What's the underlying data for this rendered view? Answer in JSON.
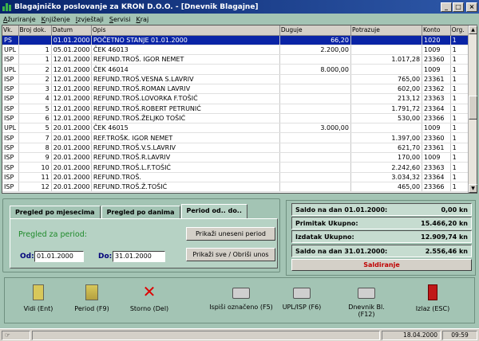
{
  "window": {
    "title": "Blagajničko poslovanje za KRON D.O.O. - [Dnevnik Blagajne]",
    "min": "_",
    "max": "□",
    "close": "×"
  },
  "menu": [
    "Ažuriranje",
    "Knjiženje",
    "Izvještaji",
    "Servisi",
    "Kraj"
  ],
  "grid": {
    "columns": [
      "Vk.",
      "Broj dok.",
      "Datum",
      "Opis",
      "Duguje",
      "Potrazuje",
      "Konto",
      "Org."
    ],
    "rows": [
      [
        "PS",
        "",
        "01.01.2000",
        "POČETNO STANJE 01.01.2000",
        "66,20",
        "",
        "1020",
        "1"
      ],
      [
        "UPL",
        "1",
        "05.01.2000",
        "ČEK 46013",
        "2.200,00",
        "",
        "1009",
        "1"
      ],
      [
        "ISP",
        "1",
        "12.01.2000",
        "REFUND.TROŠ. IGOR NEMET",
        "",
        "1.017,28",
        "23360",
        "1"
      ],
      [
        "UPL",
        "2",
        "12.01.2000",
        "ČEK 46014",
        "8.000,00",
        "",
        "1009",
        "1"
      ],
      [
        "ISP",
        "2",
        "12.01.2000",
        "REFUND.TROŠ.VESNA S.LAVRIV",
        "",
        "765,00",
        "23361",
        "1"
      ],
      [
        "ISP",
        "3",
        "12.01.2000",
        "REFUND.TROŠ.ROMAN LAVRIV",
        "",
        "602,00",
        "23362",
        "1"
      ],
      [
        "ISP",
        "4",
        "12.01.2000",
        "REFUND.TROŠ.LOVORKA F.TOŠIĆ",
        "",
        "213,12",
        "23363",
        "1"
      ],
      [
        "ISP",
        "5",
        "12.01.2000",
        "REFUND.TROŠ.ROBERT PETRUNIĆ",
        "",
        "1.791,72",
        "23364",
        "1"
      ],
      [
        "ISP",
        "6",
        "12.01.2000",
        "REFUND.TROŠ.ŽELJKO TOŠIĆ",
        "",
        "530,00",
        "23366",
        "1"
      ],
      [
        "UPL",
        "5",
        "20.01.2000",
        "ČEK 46015",
        "3.000,00",
        "",
        "1009",
        "1"
      ],
      [
        "ISP",
        "7",
        "20.01.2000",
        "REF.TROŠK. IGOR NEMET",
        "",
        "1.397,00",
        "23360",
        "1"
      ],
      [
        "ISP",
        "8",
        "20.01.2000",
        "REFUND.TROŠ.V.S.LAVRIV",
        "",
        "621,70",
        "23361",
        "1"
      ],
      [
        "ISP",
        "9",
        "20.01.2000",
        "REFUND.TROŠ.R.LAVRIV",
        "",
        "170,00",
        "1009",
        "1"
      ],
      [
        "ISP",
        "10",
        "20.01.2000",
        "REFUND.TROŠ.L.F.TOŠIĆ",
        "",
        "2.242,60",
        "23363",
        "1"
      ],
      [
        "ISP",
        "11",
        "20.01.2000",
        "REFUND.TROŠ.",
        "",
        "3.034,32",
        "23364",
        "1"
      ],
      [
        "ISP",
        "12",
        "20.01.2000",
        "REFUND.TROŠ.Ž.TOŠIĆ",
        "",
        "465,00",
        "23366",
        "1"
      ]
    ]
  },
  "tabs": [
    "Pregled po mjesecima",
    "Pregled po danima",
    "Period od.. do.."
  ],
  "period": {
    "title": "Pregled za period:",
    "from_label": "Od:",
    "from": "01.01.2000",
    "to_label": "Do:",
    "to": "31.01.2000",
    "btn_show": "Prikaži uneseni period",
    "btn_all": "Prikaži sve / Obriši unos"
  },
  "summary": {
    "rows": [
      {
        "label": "Saldo na dan 01.01.2000:",
        "value": "0,00 kn"
      },
      {
        "label": "Primitak Ukupno:",
        "value": "15.466,20 kn"
      },
      {
        "label": "Izdatak Ukupno:",
        "value": "12.909,74 kn"
      },
      {
        "label": "Saldo na dan 31.01.2000:",
        "value": "2.556,46 kn"
      }
    ],
    "saldiranje": "Saldiranje"
  },
  "toolbar": [
    {
      "icon": "view-document-icon",
      "label": "Vidi (Ent)"
    },
    {
      "icon": "period-document-icon",
      "label": "Period (F9)"
    },
    {
      "icon": "storno-x-icon",
      "label": "Storno (Del)"
    },
    {
      "icon": "printer-icon",
      "label": "Ispiši označeno (F5)"
    },
    {
      "icon": "printer-icon",
      "label": "UPL/ISP (F6)"
    },
    {
      "icon": "printer-icon",
      "label": "Dnevnik Bl. (F12)"
    },
    {
      "icon": "exit-door-icon",
      "label": "Izlaz (ESC)"
    }
  ],
  "status": {
    "date": "18.04.2000",
    "time": "09:59"
  },
  "colors": {
    "titlebar": "#08246b",
    "selection": "#0a24a6",
    "background": "#a3c4b4",
    "accent_red": "#c00000"
  }
}
